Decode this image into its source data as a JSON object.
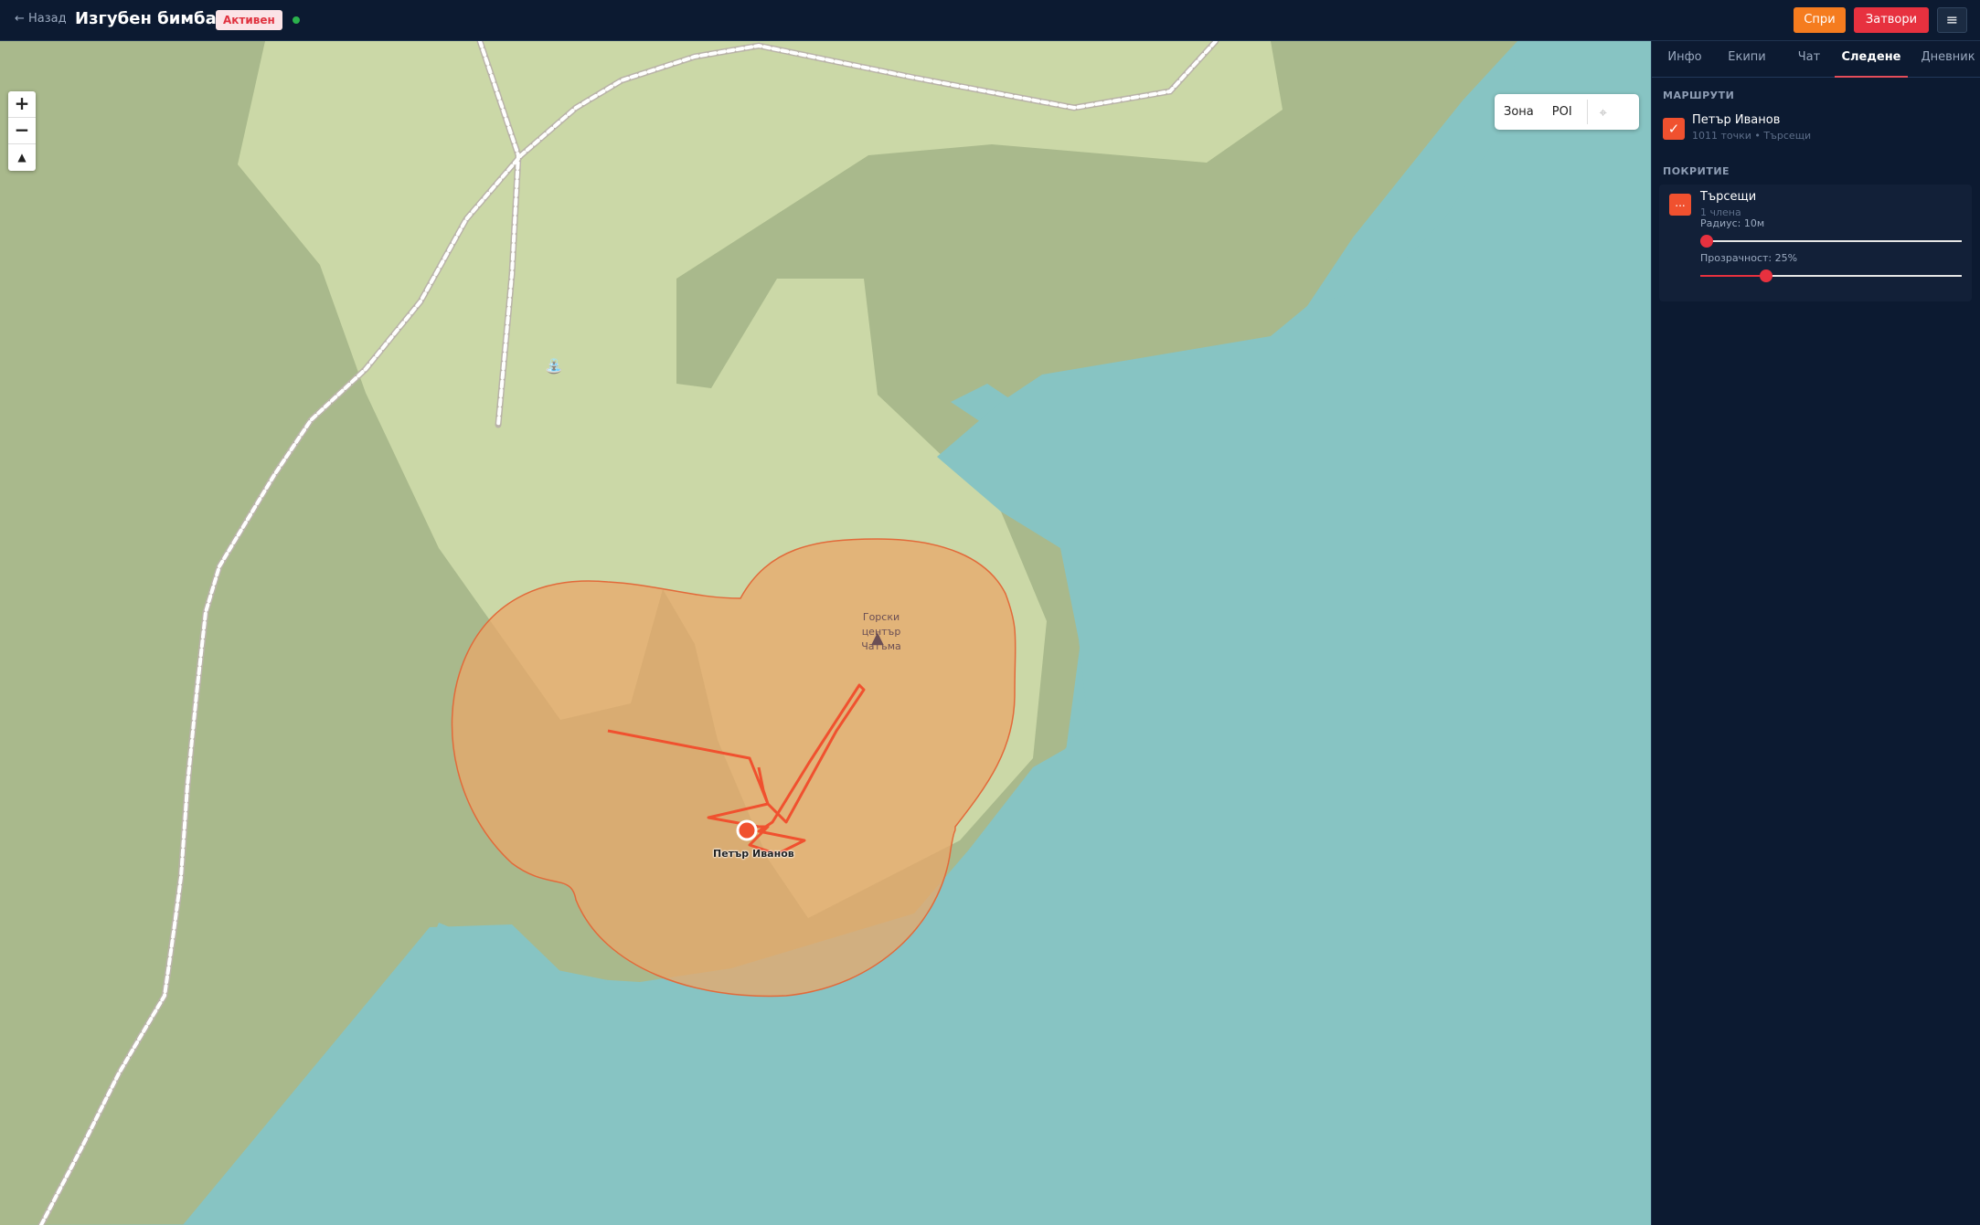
{
  "header": {
    "back_label": "← Назад",
    "title": "Изгубен бимбаец",
    "status": "Активен",
    "stop_label": "Спри",
    "close_label": "Затвори",
    "menu_icon": "≡"
  },
  "map": {
    "zoom_in": "+",
    "zoom_out": "−",
    "reset_north": "▲",
    "layers": {
      "zone": "Зона",
      "poi": "POI",
      "locate_icon": "⌖"
    },
    "poi_label": [
      "Горски",
      "център",
      "Чатъма"
    ],
    "tracked_person": "Петър Иванов"
  },
  "sidebar": {
    "tabs": [
      "Инфо",
      "Екипи",
      "Чат",
      "Следене",
      "Дневник"
    ],
    "active_tab": "Следене",
    "routes_title": "МАРШРУТИ",
    "route": {
      "name": "Петър Иванов",
      "meta": "1011 точки • Търсещи",
      "checked": true
    },
    "coverage_title": "ПОКРИТИЕ",
    "coverage": {
      "name": "Търсещи",
      "meta": "1 члена",
      "swatch": "...",
      "radius_label": "Радиус: 10м",
      "radius_fraction": 0.0,
      "opacity_label": "Прозрачност: 25%",
      "opacity_fraction": 0.25
    }
  },
  "colors": {
    "accent": "#f0512f",
    "danger": "#e7313f",
    "stop": "#f57c1f",
    "water": "#87c4c3",
    "coverage": "#e9a86a"
  }
}
